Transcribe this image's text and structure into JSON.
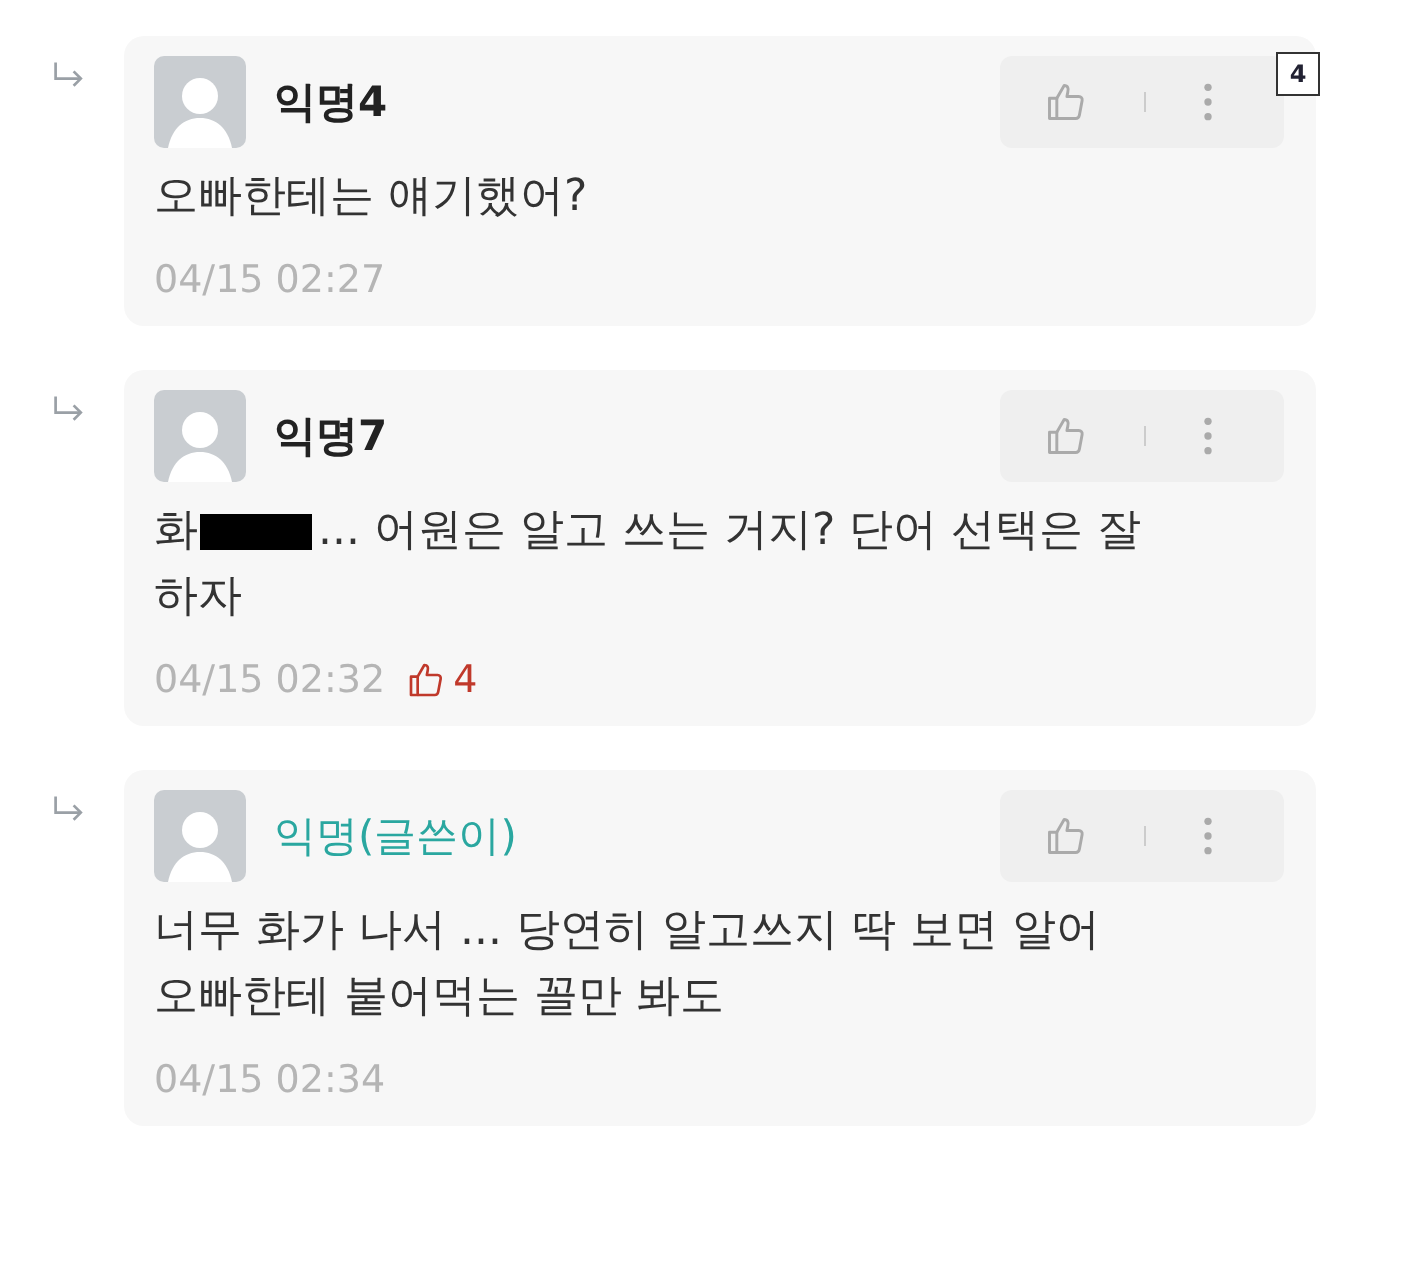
{
  "marker": "4",
  "comments": [
    {
      "author": "익명4",
      "is_author": false,
      "body": [
        {
          "kind": "text",
          "text": "오빠한테는 얘기했어?"
        }
      ],
      "time": "04/15 02:27"
    },
    {
      "author": "익명7",
      "is_author": false,
      "body": [
        {
          "kind": "line",
          "parts": [
            {
              "kind": "text",
              "text": "화"
            },
            {
              "kind": "redacted"
            },
            {
              "kind": "text",
              "text": "... 어원은 알고 쓰는 거지? 단어 선택은 잘"
            }
          ]
        },
        {
          "kind": "text",
          "text": "하자"
        }
      ],
      "time": "04/15 02:32",
      "likes": "4"
    },
    {
      "author": "익명(글쓴이)",
      "is_author": true,
      "body": [
        {
          "kind": "text",
          "text": "너무 화가 나서 ... 당연히 알고쓰지 딱 보면 알어 오빠한테 붙어먹는 꼴만 봐도"
        }
      ],
      "time": "04/15 02:34"
    }
  ]
}
